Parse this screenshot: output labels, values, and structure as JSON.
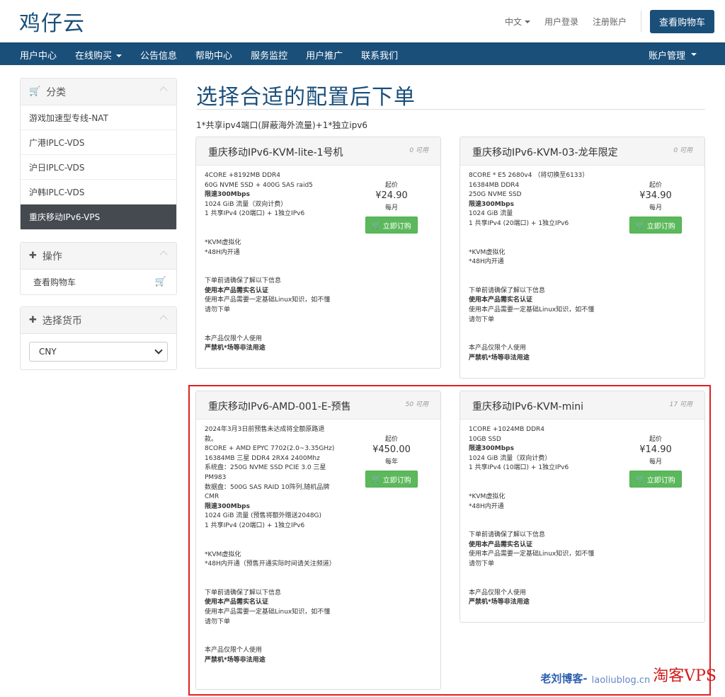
{
  "header": {
    "logo": "鸡仔云",
    "language": "中文",
    "login": "用户登录",
    "register": "注册账户",
    "view_cart": "查看购物车"
  },
  "nav": {
    "items": [
      "用户中心",
      "在线购买",
      "公告信息",
      "帮助中心",
      "服务监控",
      "用户推广",
      "联系我们"
    ],
    "account": "账户管理"
  },
  "sidebar": {
    "categories": {
      "title": "分类",
      "items": [
        "游戏加速型专线-NAT",
        "广港IPLC-VDS",
        "沪日IPLC-VDS",
        "沪韩IPLC-VDS",
        "重庆移动IPv6-VPS"
      ],
      "active_index": 4
    },
    "actions": {
      "title": "操作",
      "cart": "查看购物车"
    },
    "currency": {
      "title": "选择货币",
      "selected": "CNY"
    }
  },
  "main": {
    "title": "选择合适的配置后下单",
    "subtitle": "1*共享ipv4端口(屏蔽海外流量)+1*独立ipv6",
    "products": [
      {
        "name": "重庆移动IPv6-KVM-lite-1号机",
        "availability": "0 可用",
        "specs": [
          "4CORE +8192MB DDR4",
          "60G NVME SSD + 400G SAS raid5",
          "限速300Mbps",
          "1024 GiB 流量（双向计费）",
          "1 共享IPv4 (20端口) + 1独立IPv6"
        ],
        "price_label": "起价",
        "price": "¥24.90",
        "cycle": "每月",
        "order": "立即订购"
      },
      {
        "name": "重庆移动IPv6-KVM-03-龙年限定",
        "availability": "0 可用",
        "specs": [
          "8CORE * E5 2680v4 （将切换至6133）",
          "16384MB DDR4",
          "250G NVME SSD",
          "限速300Mbps",
          "1024 GiB 流量",
          "1 共享IPv4 (20端口) + 1独立IPv6"
        ],
        "price_label": "起价",
        "price": "¥34.90",
        "cycle": "每月",
        "order": "立即订购"
      },
      {
        "name": "重庆移动IPv6-AMD-001-E-预售",
        "availability": "50 可用",
        "specs": [
          "2024年3月3日前预售未达成将全额原路退款。",
          "8CORE + AMD EPYC 7702(2.0~3.35GHz)",
          "16384MB 三星 DDR4 2RX4 2400Mhz",
          "系统盘：250G NVME SSD PCIE 3.0 三星PM983",
          "数据盘：500G SAS RAID 10阵列,随机品牌CMR",
          "限速300Mbps",
          "1024 GiB 流量 (预售将额外赠送2048G)",
          "1 共享IPv4 (20端口) + 1独立IPv6"
        ],
        "notes_kvm": "*KVM虚拟化",
        "notes_open": "*48H内开通（预售开通实际时间请关注频道）",
        "price_label": "起价",
        "price": "¥450.00",
        "cycle": "每年",
        "order": "立即订购"
      },
      {
        "name": "重庆移动IPv6-KVM-mini",
        "availability": "17 可用",
        "specs": [
          "1CORE +1024MB DDR4",
          "10GB SSD",
          "限速300Mbps",
          "1024 GiB 流量（双向计费）",
          "1 共享IPv4 (10端口) + 1独立IPv6"
        ],
        "price_label": "起价",
        "price": "¥14.90",
        "cycle": "每月",
        "order": "立即订购"
      }
    ],
    "common": {
      "kvm": "*KVM虚拟化",
      "open48": "*48H内开通",
      "notice_title": "下单前请确保了解以下信息",
      "realname": "使用本产品需实名认证",
      "linux": "使用本产品需要一定基础Linux知识，如不懂请勿下单",
      "personal": "本产品仅限个人使用",
      "forbidden": "严禁机*场等非法用途"
    }
  },
  "watermark": {
    "blog": "老刘博客-",
    "url": "laoliublog.cn",
    "brand": "淘客VPS"
  }
}
